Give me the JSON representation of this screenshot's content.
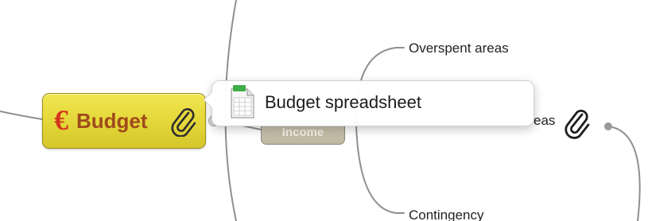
{
  "central_topic": {
    "icon": "euro-icon",
    "icon_glyph": "€",
    "label": "Budget",
    "attachment_icon": "paperclip-icon",
    "fill_color": "#e5d83a",
    "label_color": "#a04a1c",
    "icon_color": "#d4341d"
  },
  "subtopic_hidden": {
    "label": "Income",
    "fill_color": "#c6c0aa"
  },
  "branches": {
    "top_label": "Overspent areas",
    "middle_partial_label": "eas",
    "bottom_label": "Contingency",
    "middle_attachment_icon": "paperclip-icon"
  },
  "tooltip": {
    "icon": "spreadsheet-icon",
    "text": "Budget spreadsheet"
  }
}
